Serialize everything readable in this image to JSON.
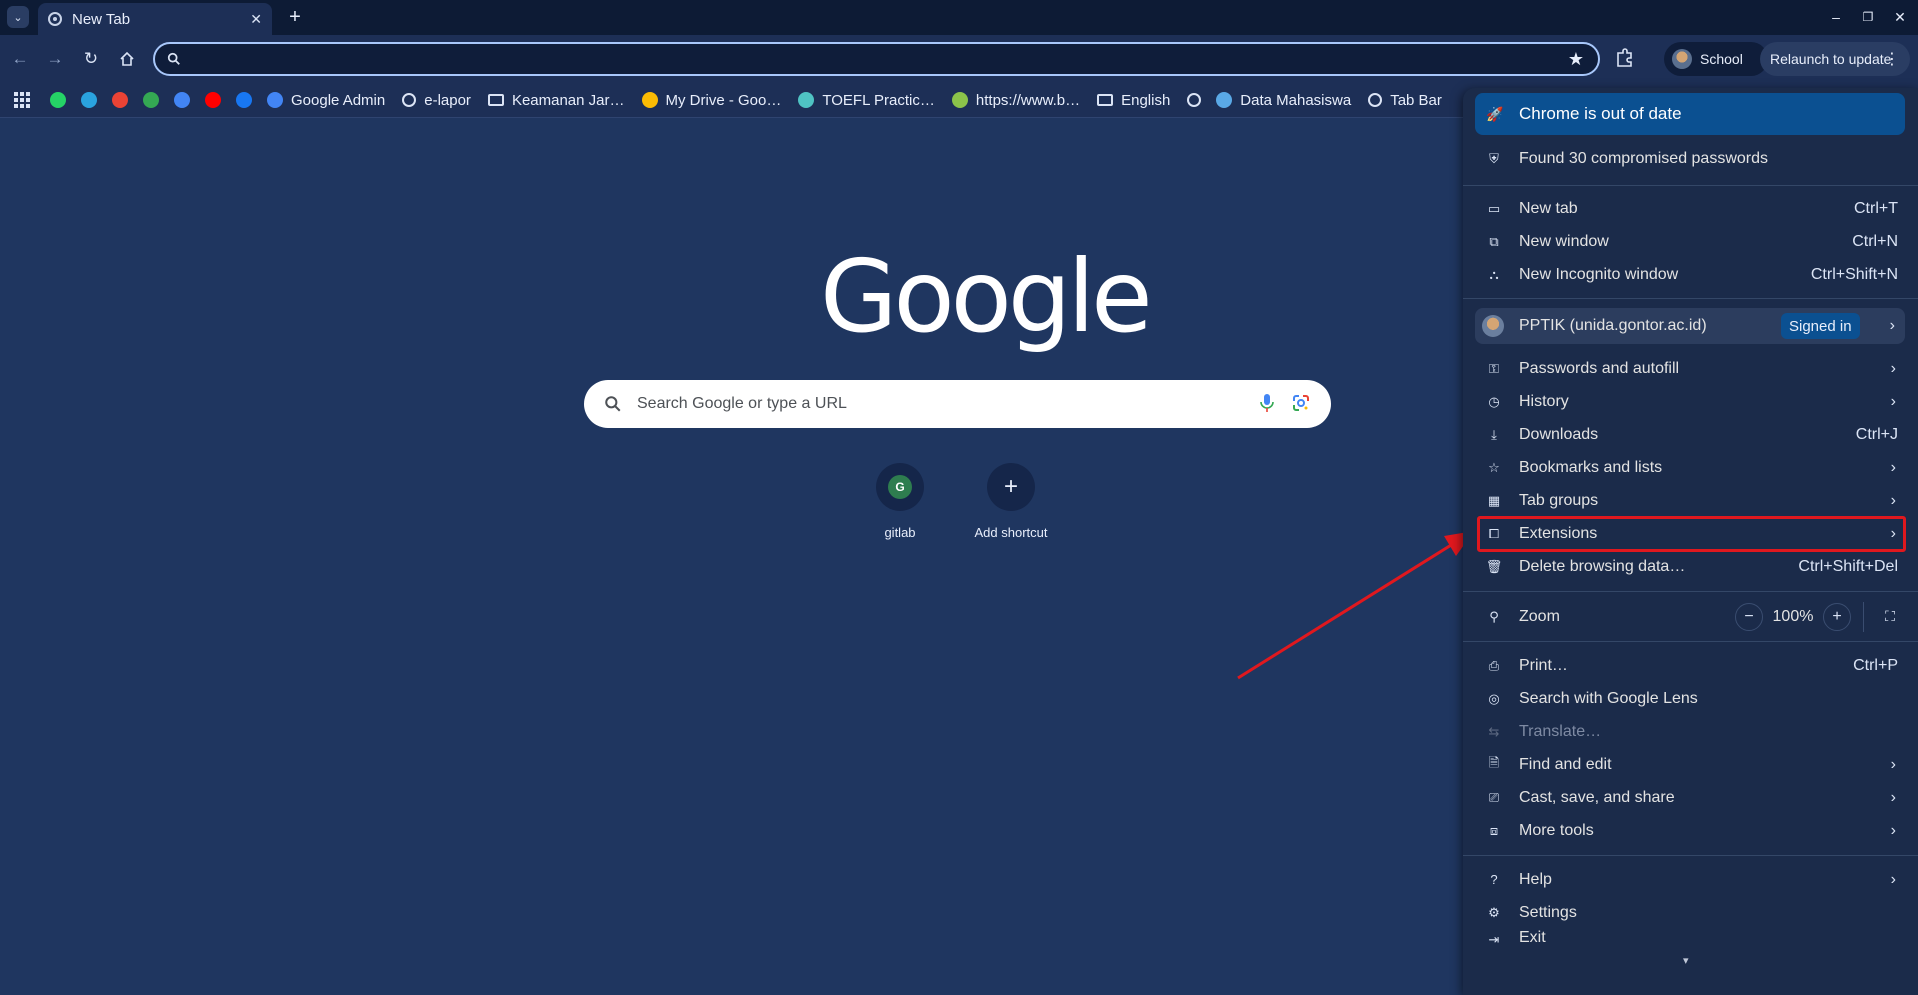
{
  "tab": {
    "title": "New Tab"
  },
  "toolbar": {
    "profile_label": "School",
    "relaunch_label": "Relaunch to update"
  },
  "bookmarks": [
    {
      "label": "",
      "icon": "whatsapp-icon",
      "color": "#25d366"
    },
    {
      "label": "",
      "icon": "telegram-icon",
      "color": "#2aa3df"
    },
    {
      "label": "",
      "icon": "gmail-icon",
      "color": "#ea4335"
    },
    {
      "label": "",
      "icon": "maps-icon",
      "color": "#34a853"
    },
    {
      "label": "",
      "icon": "translate-icon",
      "color": "#4285f4"
    },
    {
      "label": "",
      "icon": "youtube-icon",
      "color": "#ff0000"
    },
    {
      "label": "",
      "icon": "facebook-icon",
      "color": "#1877f2"
    },
    {
      "label": "Google Admin",
      "icon": "google-admin-icon",
      "color": "#4285f4"
    },
    {
      "label": "e-lapor",
      "icon": "globe-icon",
      "color": "#dbe4f5"
    },
    {
      "label": "Keamanan Jar…",
      "icon": "folder-icon",
      "color": "#dbe4f5"
    },
    {
      "label": "My Drive - Goo…",
      "icon": "drive-icon",
      "color": "#fbbc04"
    },
    {
      "label": "TOEFL Practic…",
      "icon": "asterisk-icon",
      "color": "#4fc3c3"
    },
    {
      "label": "https://www.b…",
      "icon": "globe-flag-icon",
      "color": "#8bc34a"
    },
    {
      "label": "English",
      "icon": "folder-icon",
      "color": "#dbe4f5"
    },
    {
      "label": "",
      "icon": "gauge-icon",
      "color": "#dbe4f5"
    },
    {
      "label": "Data Mahasiswa",
      "icon": "data-icon",
      "color": "#5aa9e6"
    },
    {
      "label": "Tab Bar",
      "icon": "globe-icon",
      "color": "#dbe4f5"
    }
  ],
  "ntp": {
    "logo": "Google",
    "search_placeholder": "Search Google or type a URL",
    "shortcuts": [
      {
        "label": "gitlab",
        "glyph": "G"
      },
      {
        "label": "Add shortcut",
        "glyph": "+"
      }
    ]
  },
  "menu": {
    "banner": "Chrome is out of date",
    "passwords_alert": "Found 30 compromised passwords",
    "new_tab": {
      "label": "New tab",
      "shortcut": "Ctrl+T"
    },
    "new_window": {
      "label": "New window",
      "shortcut": "Ctrl+N"
    },
    "new_incognito": {
      "label": "New Incognito window",
      "shortcut": "Ctrl+Shift+N"
    },
    "profile": {
      "name": "PPTIK (unida.gontor.ac.id)",
      "badge": "Signed in"
    },
    "passwords": "Passwords and autofill",
    "history": "History",
    "downloads": {
      "label": "Downloads",
      "shortcut": "Ctrl+J"
    },
    "bookmarks": "Bookmarks and lists",
    "tab_groups": "Tab groups",
    "extensions": "Extensions",
    "delete_data": {
      "label": "Delete browsing data…",
      "shortcut": "Ctrl+Shift+Del"
    },
    "zoom": {
      "label": "Zoom",
      "value": "100%",
      "minus": "−",
      "plus": "+"
    },
    "print": {
      "label": "Print…",
      "shortcut": "Ctrl+P"
    },
    "lens": "Search with Google Lens",
    "translate": "Translate…",
    "find_edit": "Find and edit",
    "cast": "Cast, save, and share",
    "more_tools": "More tools",
    "help": "Help",
    "settings": "Settings",
    "exit": "Exit"
  },
  "colors": {
    "annotation": "#e0181e",
    "accent": "#0b5091"
  }
}
